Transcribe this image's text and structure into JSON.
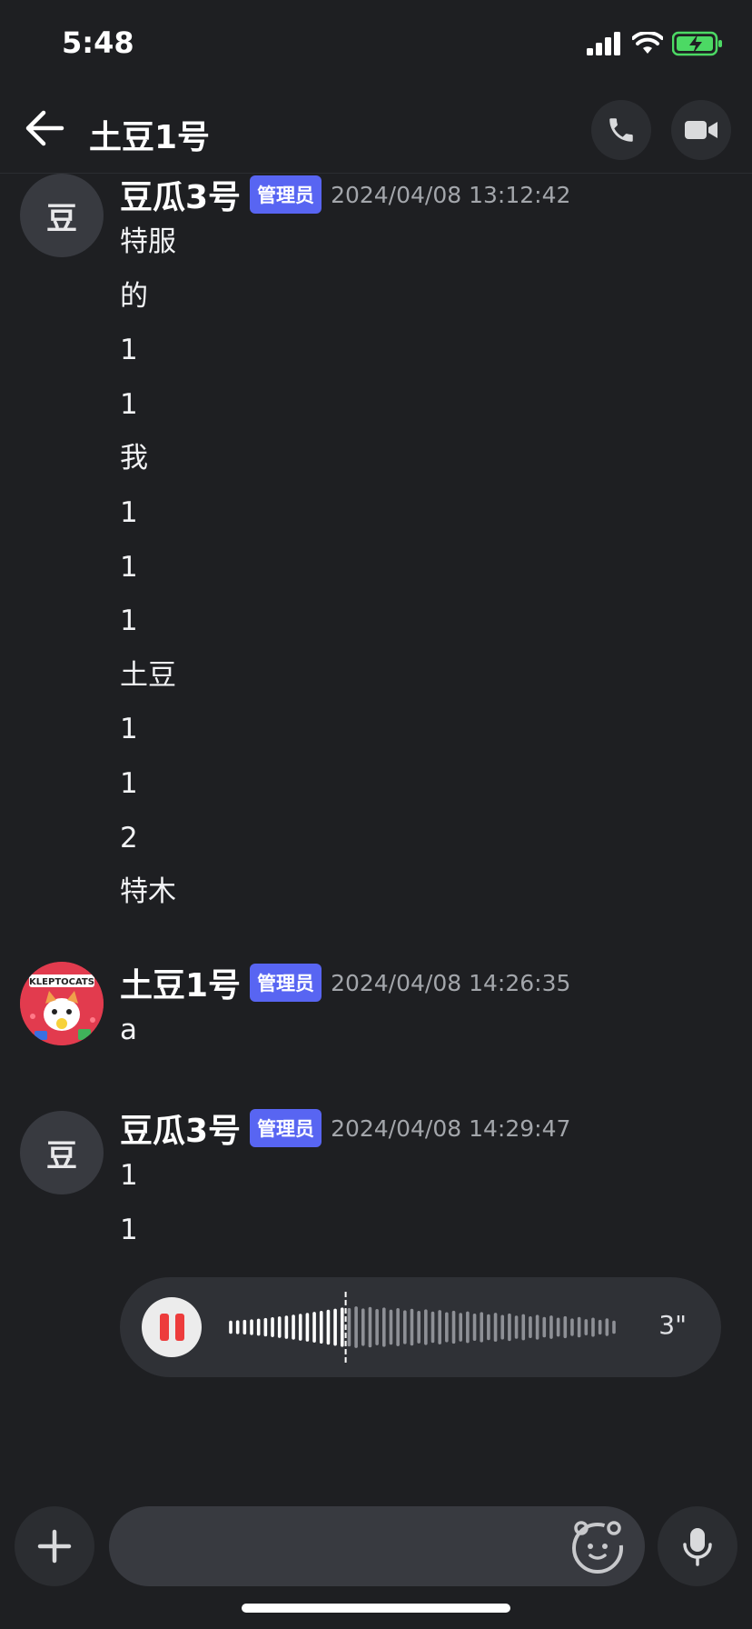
{
  "status_bar": {
    "time": "5:48"
  },
  "header": {
    "title": "土豆1号"
  },
  "messages": [
    {
      "avatar_text": "豆",
      "author": "豆瓜3号",
      "role": "管理员",
      "timestamp": "2024/04/08 13:12:42",
      "lines": [
        "特服",
        "的",
        "1",
        "1",
        "我",
        "1",
        "1",
        "1",
        "土豆",
        "1",
        "1",
        "2",
        "特木"
      ]
    },
    {
      "avatar_text": "KLEPTOCATS",
      "author": "土豆1号",
      "role": "管理员",
      "timestamp": "2024/04/08 14:26:35",
      "lines": [
        "a"
      ]
    },
    {
      "avatar_text": "豆",
      "author": "豆瓜3号",
      "role": "管理员",
      "timestamp": "2024/04/08 14:29:47",
      "lines": [
        "1",
        "1"
      ]
    }
  ],
  "voice_message": {
    "duration": "3\"",
    "progress": 0.3
  },
  "colors": {
    "background": "#1e1f22",
    "badge": "#5865f2",
    "pause": "#ed3c3c"
  },
  "icons": [
    "back-arrow-icon",
    "phone-icon",
    "video-camera-icon",
    "pause-icon",
    "plus-icon",
    "emoji-icon",
    "microphone-icon"
  ]
}
